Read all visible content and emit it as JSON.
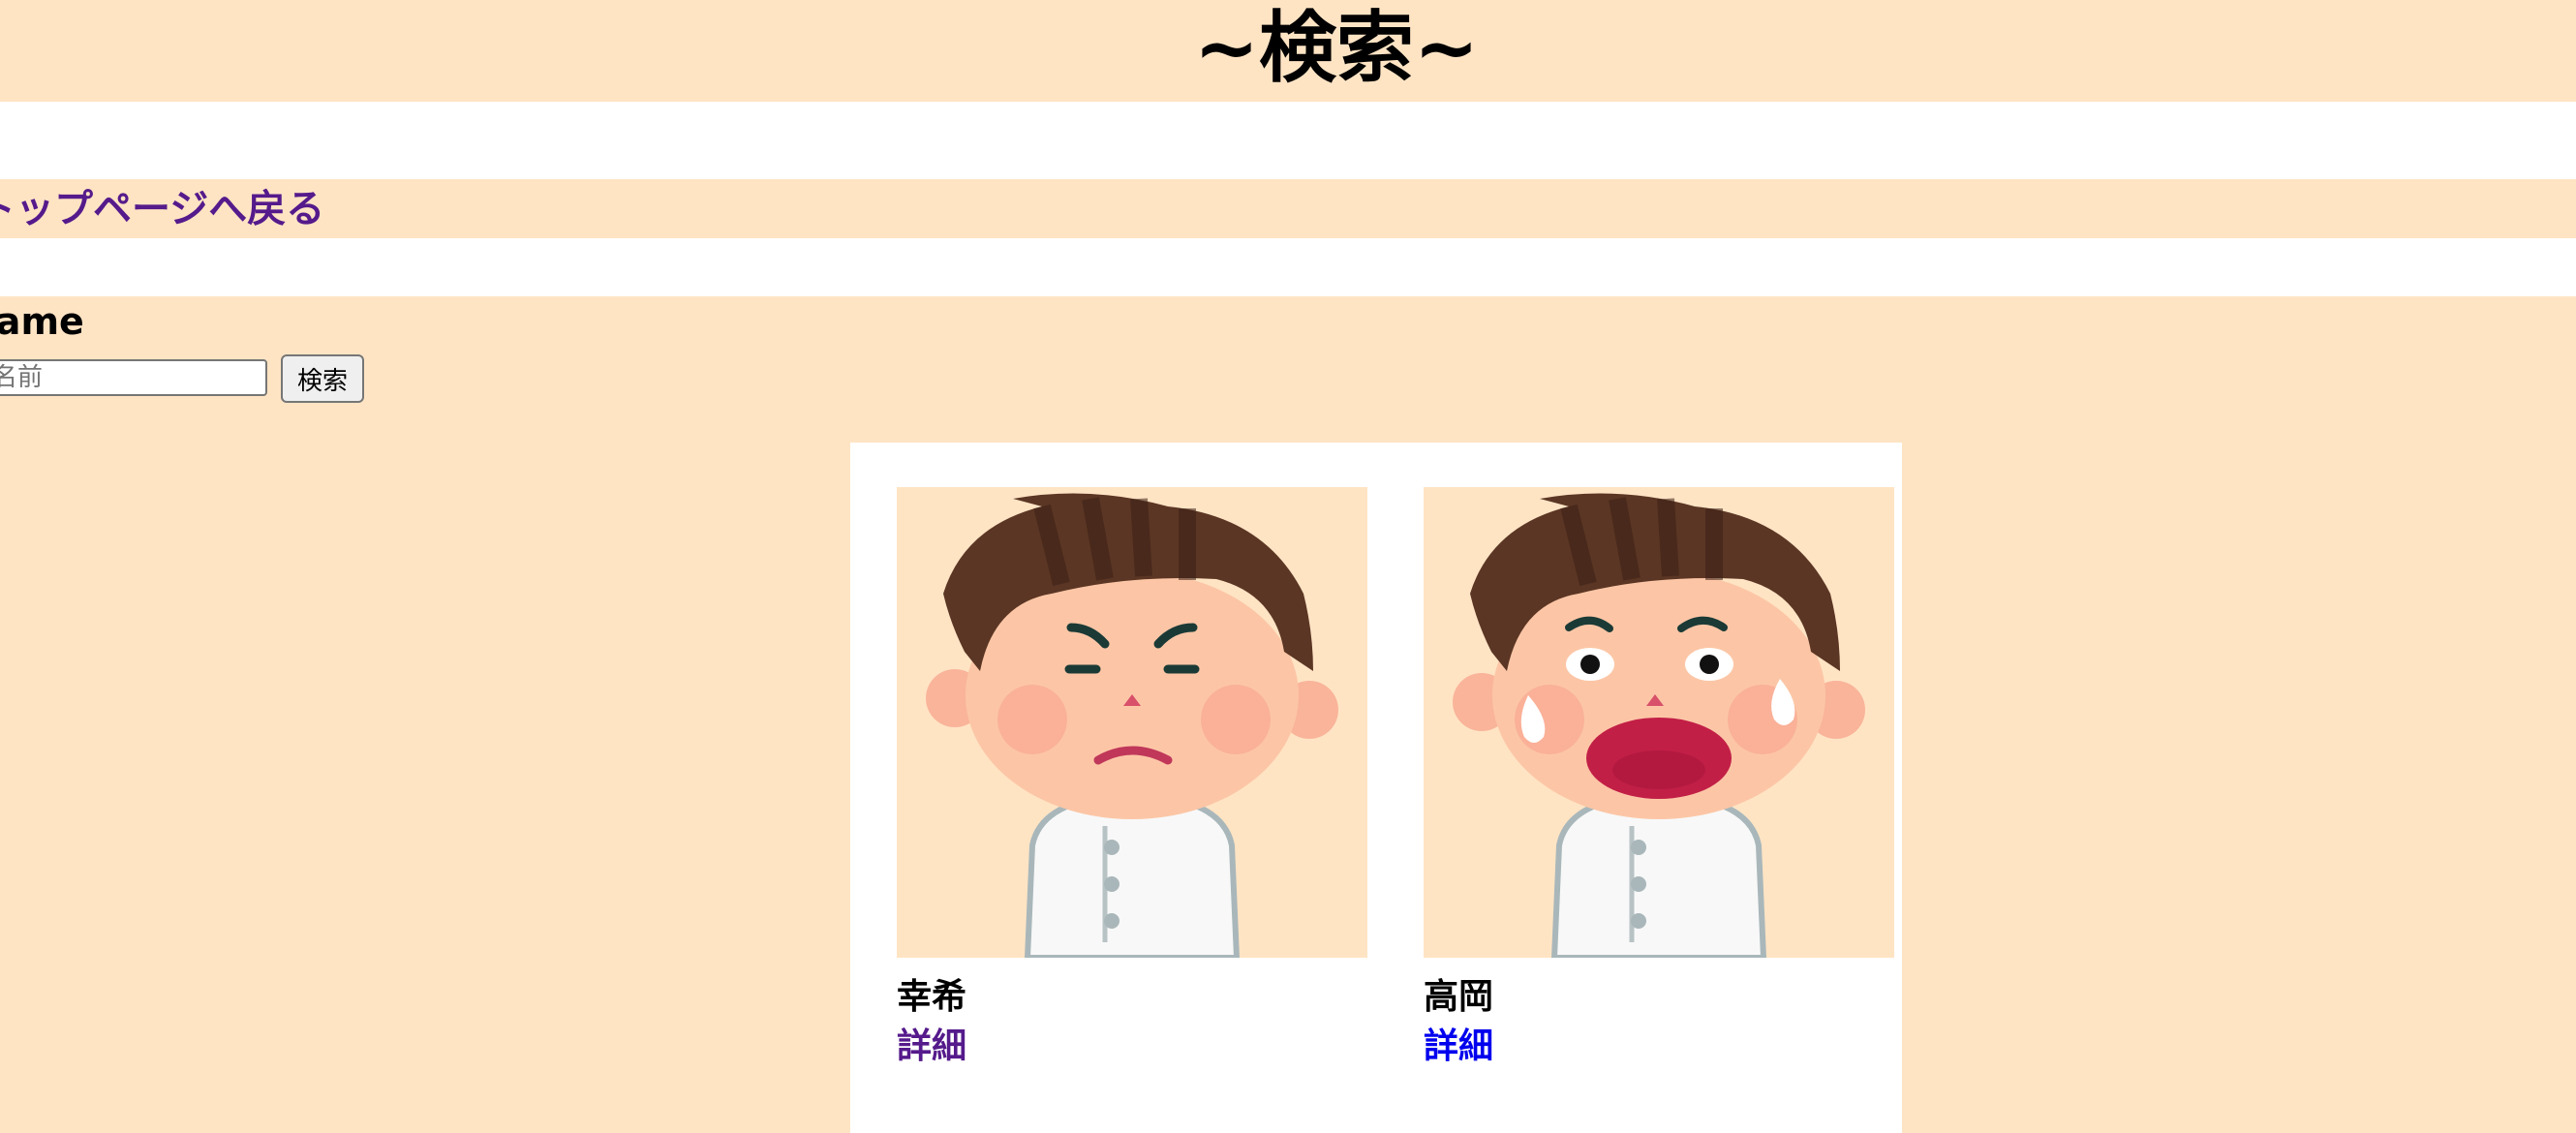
{
  "header": {
    "title": "~検索~"
  },
  "nav": {
    "back_link": "トップページへ戻る"
  },
  "search": {
    "label": "Name",
    "placeholder": "名前",
    "button_label": "検索"
  },
  "results": [
    {
      "name": "幸希",
      "detail_label": "詳細",
      "expression": "angry"
    },
    {
      "name": "高岡",
      "detail_label": "詳細",
      "expression": "shocked-crying"
    }
  ],
  "colors": {
    "background": "#ffe4c4",
    "visited_link": "#551a8b",
    "link": "#0000ee"
  }
}
